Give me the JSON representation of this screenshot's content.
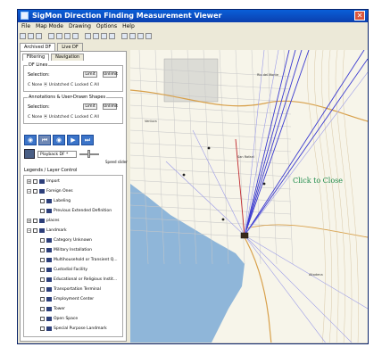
{
  "window": {
    "title": "SigMon Direction Finding Measurement Viewer",
    "close_glyph": "✕"
  },
  "menubar": [
    "File",
    "Map Mode",
    "Drawing",
    "Options",
    "Help"
  ],
  "toolbar": {
    "icons": [
      "new-icon",
      "open-icon",
      "save-icon",
      "print-icon",
      "zoom-in-icon",
      "zoom-out-icon",
      "pan-icon",
      "select-icon",
      "line-icon",
      "polygon-icon",
      "measure-icon",
      "ruler-icon",
      "layers-icon",
      "info-icon",
      "help-icon"
    ]
  },
  "left_panel": {
    "tabs": [
      "Archived DF",
      "Live DF"
    ],
    "sub_tabs": [
      "Filtering",
      "Navigation"
    ],
    "df_lines": {
      "title": "DF Lines",
      "selection_label": "Selection:",
      "limit_label": "Limit",
      "unlimit_label": "Unlimit",
      "radios": "C None  ⦿ Unlatched  C Locked  C All"
    },
    "annotations": {
      "title": "Annotations & User-Drawn Shapes",
      "selection_label": "Selection:",
      "limit_label": "Limit",
      "unlimit_label": "Unlimit",
      "radios": "C None  ⦿ Unlatched  C Locked  C All"
    },
    "playback": {
      "buttons": [
        "◉",
        "⏮",
        "◉",
        "▶",
        "⏭"
      ]
    },
    "combo_value": "Playback DF *",
    "slider_label": "Speed slider",
    "legend_title": "Legends / Layer Control",
    "tree": [
      {
        "label": "Import",
        "indent": 0,
        "expander": "+"
      },
      {
        "label": "Foreign Ones",
        "indent": 0,
        "expander": "−"
      },
      {
        "label": "Labeling",
        "indent": 1,
        "expander": ""
      },
      {
        "label": "Previous Extended Definition",
        "indent": 1,
        "expander": ""
      },
      {
        "label": "places",
        "indent": 0,
        "expander": "+"
      },
      {
        "label": "Landmark",
        "indent": 0,
        "expander": "−"
      },
      {
        "label": "Category Unknown",
        "indent": 1,
        "expander": ""
      },
      {
        "label": "Military Installation",
        "indent": 1,
        "expander": ""
      },
      {
        "label": "Multihousehold or Transient Q...",
        "indent": 1,
        "expander": ""
      },
      {
        "label": "Custodial Facility",
        "indent": 1,
        "expander": ""
      },
      {
        "label": "Educational or Religious Instit...",
        "indent": 1,
        "expander": ""
      },
      {
        "label": "Transportation Terminal",
        "indent": 1,
        "expander": ""
      },
      {
        "label": "Employment Center",
        "indent": 1,
        "expander": ""
      },
      {
        "label": "Tower",
        "indent": 1,
        "expander": ""
      },
      {
        "label": "Open Space",
        "indent": 1,
        "expander": ""
      },
      {
        "label": "Special Purpose Landmark",
        "indent": 1,
        "expander": ""
      }
    ]
  },
  "map": {
    "overlay_text": "Click to Close",
    "colors": {
      "water": "#8fb6d9",
      "land": "#f7f5ea",
      "bearing_lines": "#3a3ad0",
      "bearing_lines_light": "#9a9ae8",
      "roads": "#c8c8c8",
      "highway": "#d8a04a",
      "overlay_text": "#1e8b4a"
    },
    "labels": [
      "Rio del Monte",
      "Ventura",
      "San Rafael",
      "Altadena"
    ]
  }
}
